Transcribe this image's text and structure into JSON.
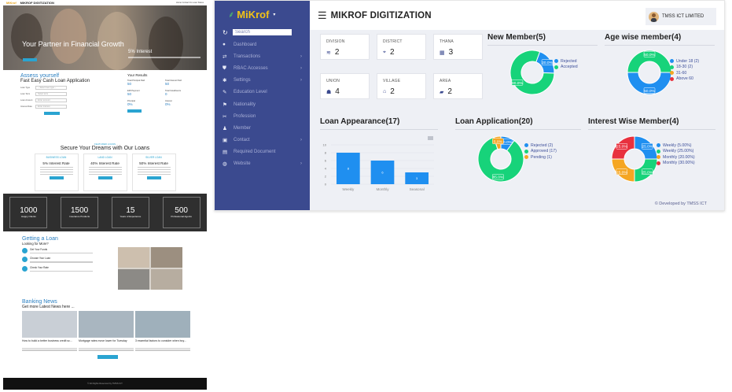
{
  "landing": {
    "brand": "MiKrof",
    "brand_title": "MIKROF DIGITIZATION",
    "top_links": "Home   Contact Us   Loan Status",
    "hero": {
      "title": "Your Partner in Financial Growth",
      "rate": "5% Interest"
    },
    "assess": {
      "title": "Assess yourself",
      "subtitle": "Fast Easy Cash Loan Application",
      "fields": [
        {
          "label": "Loan Type",
          "value": "-- Select loan type --"
        },
        {
          "label": "Loan Term",
          "value": "Select term"
        },
        {
          "label": "Loan Amount",
          "value": "Enter amount"
        },
        {
          "label": "Interest Rate",
          "value": "Enter interest"
        }
      ],
      "calc_label": "Calculate"
    },
    "results": {
      "title": "Your Results",
      "items": [
        {
          "label": "Total Principal Paid",
          "value": "50"
        },
        {
          "label": "Total Interest Paid",
          "value": "50"
        },
        {
          "label": "EMI Payment",
          "value": "50"
        },
        {
          "label": "Total Installments",
          "value": "0"
        },
        {
          "label": "Principal",
          "value": "0%"
        },
        {
          "label": "Interest",
          "value": "0%"
        }
      ],
      "apply_label": "Apply Now"
    },
    "loans": {
      "featured": "FEATURED LOANS",
      "title": "Secure Your Dreams with Our Loans",
      "cards": [
        {
          "name": "BUSINESS LOAN",
          "rate": "5% Interest Rate",
          "button": "Apply Now"
        },
        {
          "name": "LAND LOAN",
          "rate": "40% Interest Rate",
          "button": "Apply Now"
        },
        {
          "name": "SILVER LOAN",
          "rate": "50% Interest Rate",
          "button": "Apply Now"
        }
      ],
      "view_all": "View All"
    },
    "stats": [
      {
        "number": "1000",
        "label": "Happy Clients"
      },
      {
        "number": "1500",
        "label": "Insurance Products"
      },
      {
        "number": "15",
        "label": "Years of Experience"
      },
      {
        "number": "500",
        "label": "Professional Agents"
      }
    ],
    "getting": {
      "title": "Getting a Loan",
      "subtitle": "Looking for More?",
      "steps": [
        "Get Your Funds",
        "Choose Your Loan",
        "Check Your Rate"
      ]
    },
    "news": {
      "title": "Banking News",
      "subtitle": "Get more Latest News here ...",
      "items": [
        "How to build a better business credit sc...",
        "Mortgage rates move lower for Tuesday",
        "3 essential factors to consider when buy..."
      ],
      "view_more": "View More"
    },
    "footer": "© All Rights Reserved by TMSS ICT"
  },
  "sidebar": {
    "brand": "MiKrof",
    "search_placeholder": "Search",
    "items": [
      {
        "label": "Dashboard",
        "icon": "palette-icon",
        "glyph": "●",
        "chevron": false
      },
      {
        "label": "Transactions",
        "icon": "exchange-icon",
        "glyph": "⇄",
        "chevron": true
      },
      {
        "label": "RBAC Accesses",
        "icon": "shield-icon",
        "glyph": "⛊",
        "chevron": true
      },
      {
        "label": "Settings",
        "icon": "gear-icon",
        "glyph": "✱",
        "chevron": true
      },
      {
        "label": "Education Level",
        "icon": "pencil-icon",
        "glyph": "✎",
        "chevron": false
      },
      {
        "label": "Nationality",
        "icon": "flag-icon",
        "glyph": "⚑",
        "chevron": false
      },
      {
        "label": "Profession",
        "icon": "wrench-icon",
        "glyph": "✂",
        "chevron": false
      },
      {
        "label": "Member",
        "icon": "users-icon",
        "glyph": "♟",
        "chevron": false
      },
      {
        "label": "Contact",
        "icon": "contact-icon",
        "glyph": "▣",
        "chevron": true
      },
      {
        "label": "Required Document",
        "icon": "document-icon",
        "glyph": "▤",
        "chevron": false
      },
      {
        "label": "Website",
        "icon": "globe-icon",
        "glyph": "◍",
        "chevron": true
      }
    ]
  },
  "header": {
    "title": "MIKROF DIGITIZATION",
    "user": "TMSS ICT LIMITED"
  },
  "tiles": [
    {
      "label": "DIVISION",
      "value": "2",
      "icon": "layers-icon",
      "glyph": "≋"
    },
    {
      "label": "DISTRICT",
      "value": "2",
      "icon": "map-pin-icon",
      "glyph": "⌖"
    },
    {
      "label": "THANA",
      "value": "3",
      "icon": "building-icon",
      "glyph": "▦"
    },
    {
      "label": "UNION",
      "value": "4",
      "icon": "people-icon",
      "glyph": "☗"
    },
    {
      "label": "VILLAGE",
      "value": "2",
      "icon": "home-icon",
      "glyph": "⌂"
    },
    {
      "label": "AREA",
      "value": "2",
      "icon": "briefcase-icon",
      "glyph": "▰"
    }
  ],
  "panels": {
    "new_member": "New Member(5)",
    "age_wise": "Age wise member(4)",
    "loan_appearance": "Loan Appearance(17)",
    "loan_application": "Loan Application(20)",
    "interest_wise": "Interest Wise Member(4)"
  },
  "footer_note": "© Developed by TMSS ICT",
  "colors": {
    "sidebar": "#3b4a8f",
    "blue": "#1f8ff0",
    "green": "#17d37a",
    "yellow": "#f5a623",
    "red": "#e8313e"
  },
  "chart_data": [
    {
      "type": "pie",
      "title": "New Member(5)",
      "categories": [
        "Rejected",
        "Accepted"
      ],
      "values": [
        20.0,
        80.0
      ],
      "colors": [
        "#1f8ff0",
        "#17d37a"
      ],
      "labels": [
        "20.0%",
        "80.0%"
      ]
    },
    {
      "type": "pie",
      "title": "Age wise member(4)",
      "categories": [
        "Under 18 (2)",
        "18-30 (2)",
        "31-60",
        "Above 60"
      ],
      "values": [
        50.0,
        50.0,
        0,
        0
      ],
      "colors": [
        "#1f8ff0",
        "#17d37a",
        "#f5a623",
        "#e8313e"
      ],
      "labels": [
        "50.0%",
        "50.0%"
      ]
    },
    {
      "type": "bar",
      "title": "Loan Appearance(17)",
      "categories": [
        "Weekly",
        "Monthly",
        "Seasonal"
      ],
      "values": [
        8,
        6,
        3
      ],
      "ylim": [
        0,
        10
      ],
      "yticks": [
        0,
        2,
        4,
        6,
        8,
        10
      ]
    },
    {
      "type": "pie",
      "title": "Loan Application(20)",
      "categories": [
        "Rejected (2)",
        "Approved (17)",
        "Pending (1)"
      ],
      "values": [
        10.0,
        85.0,
        5.0
      ],
      "colors": [
        "#1f8ff0",
        "#17d37a",
        "#f5a623"
      ],
      "labels": [
        "10.0%",
        "85.0%",
        "5.0%"
      ]
    },
    {
      "type": "pie",
      "title": "Interest Wise Member(4)",
      "categories": [
        "Weekly (5.00%)",
        "Weekly (25.00%)",
        "Monthly (20.00%)",
        "Monthly (30.00%)"
      ],
      "values": [
        25.0,
        25.0,
        25.0,
        25.0
      ],
      "colors": [
        "#1f8ff0",
        "#17d37a",
        "#f5a623",
        "#e8313e"
      ],
      "labels": [
        "25.0%",
        "25.0%",
        "25.0%",
        "25.0%"
      ]
    }
  ]
}
